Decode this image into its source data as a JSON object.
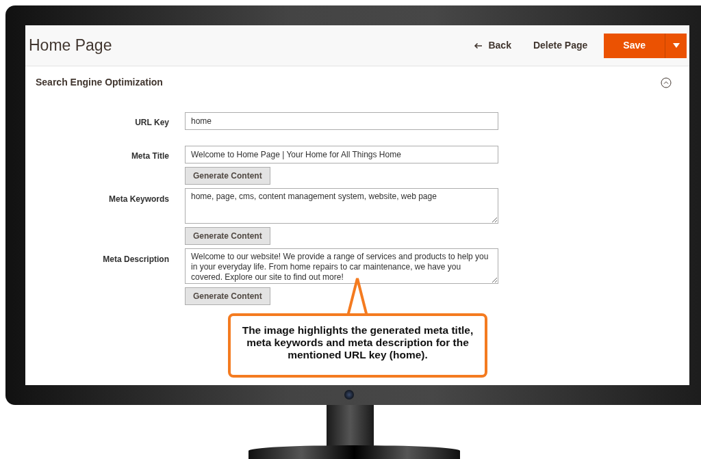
{
  "header": {
    "title": "Home Page",
    "back": "Back",
    "delete": "Delete Page",
    "save": "Save"
  },
  "section": {
    "title": "Search Engine Optimization",
    "expanded": true,
    "fields": [
      {
        "kind": "input",
        "label": "URL Key",
        "value": "home"
      },
      {
        "kind": "input",
        "label": "Meta Title",
        "value": "Welcome to Home Page | Your Home for All Things Home",
        "button": "Generate Content"
      },
      {
        "kind": "textarea",
        "label": "Meta Keywords",
        "value": "home, page, cms, content management system, website, web page",
        "button": "Generate Content"
      },
      {
        "kind": "textarea",
        "label": "Meta Description",
        "value": "Welcome to our website! We provide a range of services and products to help you in your everyday life. From home repairs to car maintenance, we have you covered. Explore our site to find out more!",
        "button": "Generate Content"
      }
    ]
  },
  "callout": {
    "text": "The image highlights the generated meta title, meta keywords and meta description for the mentioned URL key (home)."
  }
}
